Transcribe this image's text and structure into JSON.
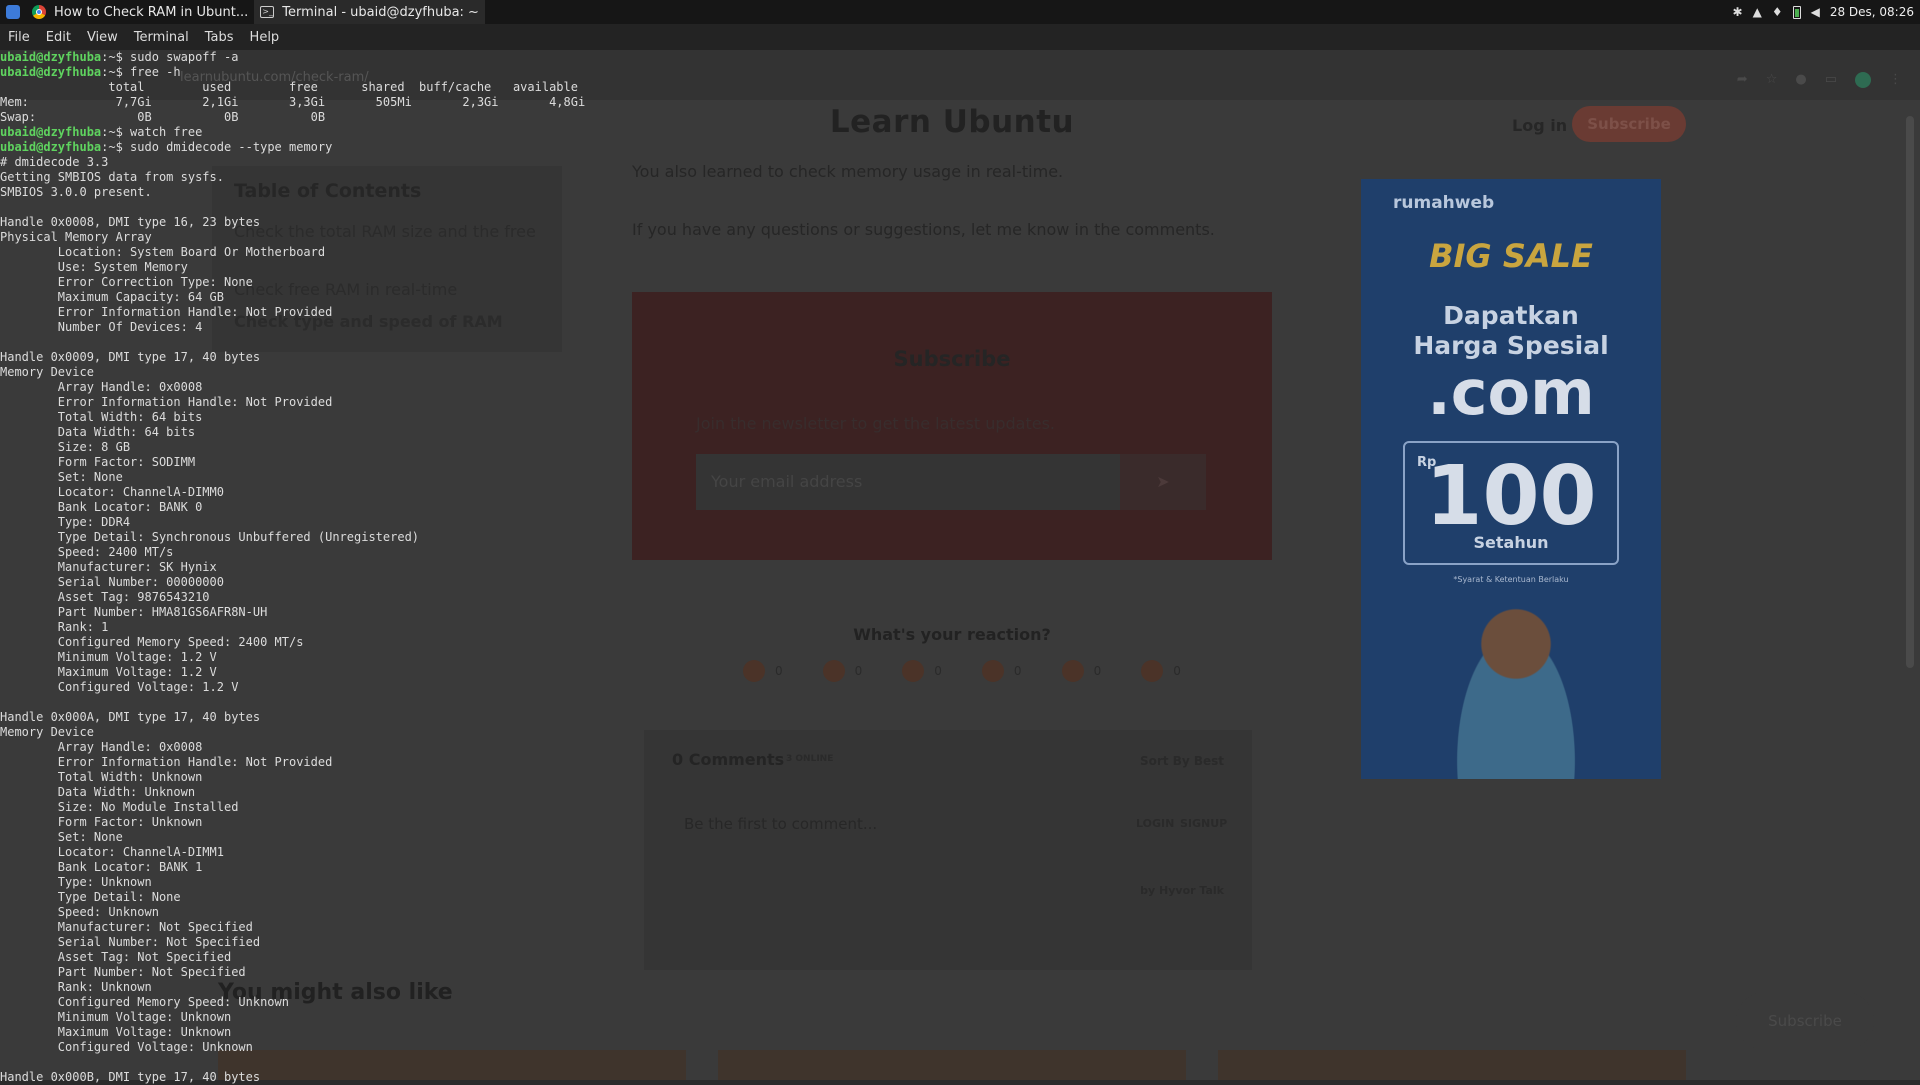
{
  "panel": {
    "tasks": [
      {
        "label": "How to Check RAM in Ubunt..."
      },
      {
        "label": "Terminal - ubaid@dzyfhuba: ~"
      }
    ],
    "clock": "28 Des, 08:26"
  },
  "terminal_menu": [
    "File",
    "Edit",
    "View",
    "Terminal",
    "Tabs",
    "Help"
  ],
  "terminal": {
    "prompt": "ubaid@dzyfhuba",
    "lines": [
      {
        "p": true,
        "cmd": ":~$ sudo swapoff -a"
      },
      {
        "p": true,
        "cmd": ":~$ free -h"
      },
      {
        "t": "               total        used        free      shared  buff/cache   available"
      },
      {
        "t": "Mem:            7,7Gi       2,1Gi       3,3Gi       505Mi       2,3Gi       4,8Gi"
      },
      {
        "t": "Swap:              0B          0B          0B"
      },
      {
        "p": true,
        "cmd": ":~$ watch free"
      },
      {
        "p": true,
        "cmd": ":~$ sudo dmidecode --type memory"
      },
      {
        "t": "# dmidecode 3.3"
      },
      {
        "t": "Getting SMBIOS data from sysfs."
      },
      {
        "t": "SMBIOS 3.0.0 present."
      },
      {
        "t": ""
      },
      {
        "t": "Handle 0x0008, DMI type 16, 23 bytes"
      },
      {
        "t": "Physical Memory Array"
      },
      {
        "t": "        Location: System Board Or Motherboard"
      },
      {
        "t": "        Use: System Memory"
      },
      {
        "t": "        Error Correction Type: None"
      },
      {
        "t": "        Maximum Capacity: 64 GB"
      },
      {
        "t": "        Error Information Handle: Not Provided"
      },
      {
        "t": "        Number Of Devices: 4"
      },
      {
        "t": ""
      },
      {
        "t": "Handle 0x0009, DMI type 17, 40 bytes"
      },
      {
        "t": "Memory Device"
      },
      {
        "t": "        Array Handle: 0x0008"
      },
      {
        "t": "        Error Information Handle: Not Provided"
      },
      {
        "t": "        Total Width: 64 bits"
      },
      {
        "t": "        Data Width: 64 bits"
      },
      {
        "t": "        Size: 8 GB"
      },
      {
        "t": "        Form Factor: SODIMM"
      },
      {
        "t": "        Set: None"
      },
      {
        "t": "        Locator: ChannelA-DIMM0"
      },
      {
        "t": "        Bank Locator: BANK 0"
      },
      {
        "t": "        Type: DDR4"
      },
      {
        "t": "        Type Detail: Synchronous Unbuffered (Unregistered)"
      },
      {
        "t": "        Speed: 2400 MT/s"
      },
      {
        "t": "        Manufacturer: SK Hynix"
      },
      {
        "t": "        Serial Number: 00000000"
      },
      {
        "t": "        Asset Tag: 9876543210"
      },
      {
        "t": "        Part Number: HMA81GS6AFR8N-UH"
      },
      {
        "t": "        Rank: 1"
      },
      {
        "t": "        Configured Memory Speed: 2400 MT/s"
      },
      {
        "t": "        Minimum Voltage: 1.2 V"
      },
      {
        "t": "        Maximum Voltage: 1.2 V"
      },
      {
        "t": "        Configured Voltage: 1.2 V"
      },
      {
        "t": ""
      },
      {
        "t": "Handle 0x000A, DMI type 17, 40 bytes"
      },
      {
        "t": "Memory Device"
      },
      {
        "t": "        Array Handle: 0x0008"
      },
      {
        "t": "        Error Information Handle: Not Provided"
      },
      {
        "t": "        Total Width: Unknown"
      },
      {
        "t": "        Data Width: Unknown"
      },
      {
        "t": "        Size: No Module Installed"
      },
      {
        "t": "        Form Factor: Unknown"
      },
      {
        "t": "        Set: None"
      },
      {
        "t": "        Locator: ChannelA-DIMM1"
      },
      {
        "t": "        Bank Locator: BANK 1"
      },
      {
        "t": "        Type: Unknown"
      },
      {
        "t": "        Type Detail: None"
      },
      {
        "t": "        Speed: Unknown"
      },
      {
        "t": "        Manufacturer: Not Specified"
      },
      {
        "t": "        Serial Number: Not Specified"
      },
      {
        "t": "        Asset Tag: Not Specified"
      },
      {
        "t": "        Part Number: Not Specified"
      },
      {
        "t": "        Rank: Unknown"
      },
      {
        "t": "        Configured Memory Speed: Unknown"
      },
      {
        "t": "        Minimum Voltage: Unknown"
      },
      {
        "t": "        Maximum Voltage: Unknown"
      },
      {
        "t": "        Configured Voltage: Unknown"
      },
      {
        "t": ""
      },
      {
        "t": "Handle 0x000B, DMI type 17, 40 bytes"
      }
    ]
  },
  "browser": {
    "url": "learnubuntu.com/check-ram/",
    "site_title": "Learn Ubuntu",
    "login": "Log in",
    "subscribe": "Subscribe",
    "toc": {
      "title": "Table of Contents",
      "items": [
        "Check the total RAM size and the free",
        "Check free RAM in real-time",
        "Check type and speed of RAM"
      ]
    },
    "article": [
      "You also learned to check memory usage in real-time.",
      "If you have any questions or suggestions, let me know in the comments."
    ],
    "newsletter": {
      "title": "Subscribe",
      "desc": "Join the newsletter to get the latest updates.",
      "placeholder": "Your email address"
    },
    "reaction_title": "What's your reaction?",
    "reactions": [
      "0",
      "0",
      "0",
      "0",
      "0",
      "0"
    ],
    "comments": {
      "count": "0 Comments",
      "online": "3 ONLINE",
      "sort": "Sort By Best",
      "placeholder": "Be the first to comment...",
      "login": "LOGIN",
      "signup": "SIGNUP",
      "powered": "by Hyvor Talk"
    },
    "also_like": "You might also like",
    "float_subscribe": "Subscribe",
    "ad": {
      "brand": "rumahweb",
      "sale": "BIG SALE",
      "line1": "Dapatkan",
      "line2": "Harga Spesial",
      "domain": ".com",
      "rp": "Rp",
      "price": "100",
      "per": "Setahun",
      "fine": "*Syarat & Ketentuan Berlaku"
    }
  }
}
